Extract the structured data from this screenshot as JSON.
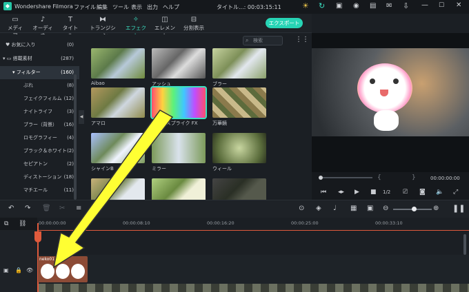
{
  "app": {
    "title": "Wondershare Filmora",
    "project": "タイトル...: 00:03:15:11"
  },
  "menu": [
    "ファイル",
    "編集",
    "ツール",
    "表示",
    "出力",
    "ヘルプ"
  ],
  "toolbar": {
    "tabs": [
      {
        "label": "メディア",
        "icon": "folder-icon"
      },
      {
        "label": "オーディオ",
        "icon": "music-note-icon"
      },
      {
        "label": "タイトル",
        "icon": "text-icon"
      },
      {
        "label": "トランジション",
        "icon": "transition-icon"
      },
      {
        "label": "エフェクト",
        "icon": "effects-icon"
      },
      {
        "label": "エレメント",
        "icon": "element-icon"
      },
      {
        "label": "分割表示",
        "icon": "split-screen-icon"
      }
    ],
    "export_label": "エクスポート"
  },
  "sidebar": {
    "items": [
      {
        "label": "お気に入り",
        "count": "(0)"
      },
      {
        "label": "搭載素材",
        "count": "(287)"
      },
      {
        "label": "フィルター",
        "count": "(160)"
      },
      {
        "label": "ぶれ",
        "count": "(8)"
      },
      {
        "label": "フェイクフィルム",
        "count": "(12)"
      },
      {
        "label": "ナイトライフ",
        "count": "(3)"
      },
      {
        "label": "ブラー（背景）",
        "count": "(16)"
      },
      {
        "label": "ロモグラフィー",
        "count": "(4)"
      },
      {
        "label": "ブラック＆ホワイト",
        "count": "(2)"
      },
      {
        "label": "セピアトン",
        "count": "(2)"
      },
      {
        "label": "ディストーション",
        "count": "(18)"
      },
      {
        "label": "マチエール",
        "count": "(11)"
      }
    ]
  },
  "search": {
    "placeholder": "検索"
  },
  "effects": [
    {
      "label": "Aibao"
    },
    {
      "label": "アッシュ"
    },
    {
      "label": "ブラー"
    },
    {
      "label": "アマロ"
    },
    {
      "label": "カラースプライク FX"
    },
    {
      "label": "万華鏡"
    },
    {
      "label": "シャインB"
    },
    {
      "label": "ミラー"
    },
    {
      "label": "ウィール"
    },
    {
      "label": ""
    },
    {
      "label": ""
    },
    {
      "label": ""
    }
  ],
  "preview": {
    "timecode": "00:00:00:00",
    "speed": "1/2"
  },
  "timeline": {
    "ruler": [
      "00:00:00:00",
      "00:00:08:10",
      "00:00:16:20",
      "00:00:25:00",
      "00:00:33:10"
    ],
    "clip_label": "neko01"
  },
  "colors": {
    "accent": "#27d4b5",
    "playhead": "#e05a3c",
    "arrow": "#ffff33"
  }
}
